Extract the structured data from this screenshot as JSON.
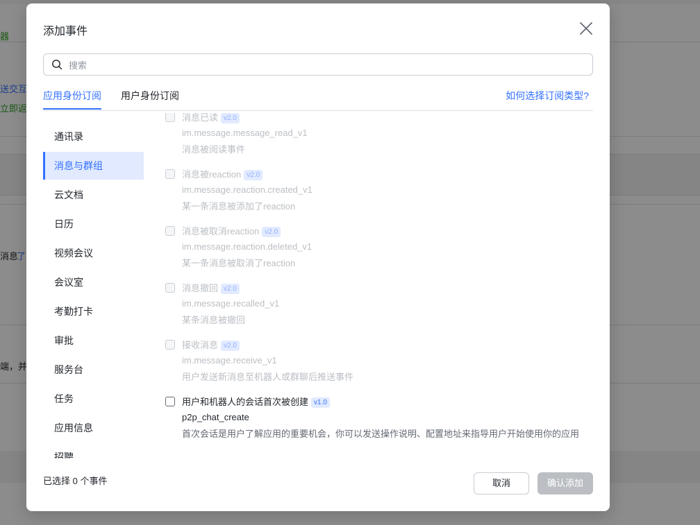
{
  "background": {
    "snippets": [
      "器",
      "送交互行",
      "立即返回",
      "消息",
      "了",
      "端，并确"
    ]
  },
  "modal": {
    "title": "添加事件",
    "search_placeholder": "搜索",
    "tabs": [
      {
        "label": "应用身份订阅",
        "active": true
      },
      {
        "label": "用户身份订阅",
        "active": false
      }
    ],
    "help_link": "如何选择订阅类型?",
    "categories": [
      {
        "label": "通讯录",
        "active": false
      },
      {
        "label": "消息与群组",
        "active": true
      },
      {
        "label": "云文档",
        "active": false
      },
      {
        "label": "日历",
        "active": false
      },
      {
        "label": "视频会议",
        "active": false
      },
      {
        "label": "会议室",
        "active": false
      },
      {
        "label": "考勤打卡",
        "active": false
      },
      {
        "label": "审批",
        "active": false
      },
      {
        "label": "服务台",
        "active": false
      },
      {
        "label": "任务",
        "active": false
      },
      {
        "label": "应用信息",
        "active": false
      },
      {
        "label": "招聘",
        "active": false
      }
    ],
    "events": [
      {
        "name": "消息已读",
        "version": "v2.0",
        "code": "im.message.message_read_v1",
        "desc": "消息被阅读事件",
        "enabled": false
      },
      {
        "name": "消息被reaction",
        "version": "v2.0",
        "code": "im.message.reaction.created_v1",
        "desc": "某一条消息被添加了reaction",
        "enabled": false
      },
      {
        "name": "消息被取消reaction",
        "version": "v2.0",
        "code": "im.message.reaction.deleted_v1",
        "desc": "某一条消息被取消了reaction",
        "enabled": false
      },
      {
        "name": "消息撤回",
        "version": "v2.0",
        "code": "im.message.recalled_v1",
        "desc": "某条消息被撤回",
        "enabled": false
      },
      {
        "name": "接收消息",
        "version": "v2.0",
        "code": "im.message.receive_v1",
        "desc": "用户发送新消息至机器人或群聊后推送事件",
        "enabled": false
      },
      {
        "name": "用户和机器人的会话首次被创建",
        "version": "v1.0",
        "code": "p2p_chat_create",
        "desc": "首次会话是用户了解应用的重要机会，你可以发送操作说明、配置地址来指导用户开始使用你的应用",
        "enabled": true
      }
    ],
    "footer": {
      "selected_count": "已选择 0 个事件",
      "cancel_label": "取消",
      "confirm_label": "确认添加"
    }
  }
}
